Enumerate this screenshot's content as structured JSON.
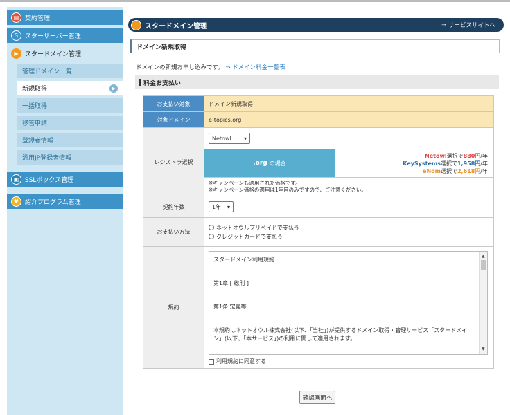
{
  "sidebar": {
    "contract": "契約管理",
    "starserver": "スターサーバー管理",
    "stardomain": "スタードメイン管理",
    "sub": [
      "管理ドメイン一覧",
      "新規取得",
      "一括取得",
      "移管申請",
      "登録者情報",
      "汎用JP登録者情報"
    ],
    "ssl": "SSLボックス管理",
    "affiliate": "紹介プログラム管理"
  },
  "header": {
    "title": "スタードメイン管理",
    "link": "⇒ サービスサイトへ"
  },
  "page": {
    "section_title": "ドメイン新規取得",
    "intro": "ドメインの新規お申し込みです。",
    "intro_link": "⇒ ドメイン料金一覧表",
    "payment_head": "料金お支払い"
  },
  "form": {
    "target_label": "お支払い対象",
    "target_value": "ドメイン新規取得",
    "domain_label": "対象ドメイン",
    "domain_value": "e-topics.org",
    "registrar_label": "レジストラ選択",
    "registrar_select": "Netowl",
    "org_tld": ".org",
    "org_suffix": "の場合",
    "prices": [
      {
        "name": "Netowl",
        "pre": "選択で",
        "price": "880円",
        "post": "/年"
      },
      {
        "name": "KeySystems",
        "pre": "選択で",
        "price": "1,958円",
        "post": "/年"
      },
      {
        "name": "eNom",
        "pre": "選択で",
        "price": "2,618円",
        "post": "/年"
      }
    ],
    "note1": "※キャンペーンも適用された価格です。",
    "note2": "※キャンペーン価格の適用は1年目のみですので、ご注意ください。",
    "years_label": "契約年数",
    "years_select": "1年",
    "payment_label": "お支払い方法",
    "payment_opt1": "ネットオウルプリペイドで支払う",
    "payment_opt2": "クレジットカードで支払う",
    "terms_label": "規約",
    "terms": [
      "スタードメイン利用規約",
      "第1章 [ 総則 ]",
      "第1条 定義等",
      "本規約はネットオウル株式会社(以下、「当社」)が提供するドメイン取得・管理サービス「スタードメイン」(以下、「本サービス」)の利用に関して適用されます。"
    ],
    "agree": "利用規約に同意する"
  },
  "confirm_button": "確認画面へ"
}
